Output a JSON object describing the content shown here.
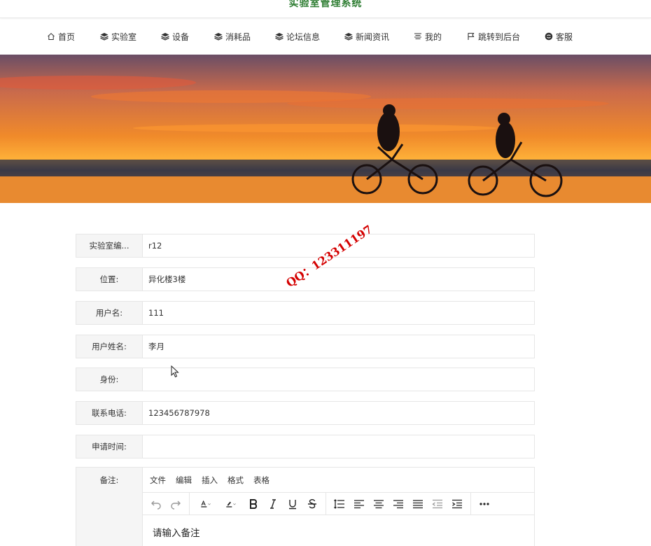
{
  "site": {
    "title": "实验室管理系统"
  },
  "nav": {
    "items": [
      {
        "label": "首页",
        "icon": "home-icon"
      },
      {
        "label": "实验室",
        "icon": "layers-icon"
      },
      {
        "label": "设备",
        "icon": "layers-icon"
      },
      {
        "label": "消耗品",
        "icon": "layers-icon"
      },
      {
        "label": "论坛信息",
        "icon": "layers-icon"
      },
      {
        "label": "新闻资讯",
        "icon": "layers-icon"
      },
      {
        "label": "我的",
        "icon": "menu-lines-icon"
      },
      {
        "label": "跳转到后台",
        "icon": "flag-icon"
      },
      {
        "label": "客服",
        "icon": "chat-icon"
      }
    ]
  },
  "form": {
    "fields": [
      {
        "label": "实验室编...",
        "value": "r12"
      },
      {
        "label": "位置:",
        "value": "异化楼3楼"
      },
      {
        "label": "用户名:",
        "value": "111"
      },
      {
        "label": "用户姓名:",
        "value": "李月"
      },
      {
        "label": "身份:",
        "value": ""
      },
      {
        "label": "联系电话:",
        "value": "123456787978"
      },
      {
        "label": "申请时间:",
        "value": ""
      }
    ],
    "remark": {
      "label": "备注:",
      "menu": [
        "文件",
        "编辑",
        "插入",
        "格式",
        "表格"
      ],
      "placeholder": "请输入备注"
    }
  },
  "watermark": "QQ：123311197",
  "colors": {
    "title": "#2e7d32",
    "watermark": "#d40000",
    "label_bg": "#f5f5f5",
    "border": "#e6e6e6"
  }
}
